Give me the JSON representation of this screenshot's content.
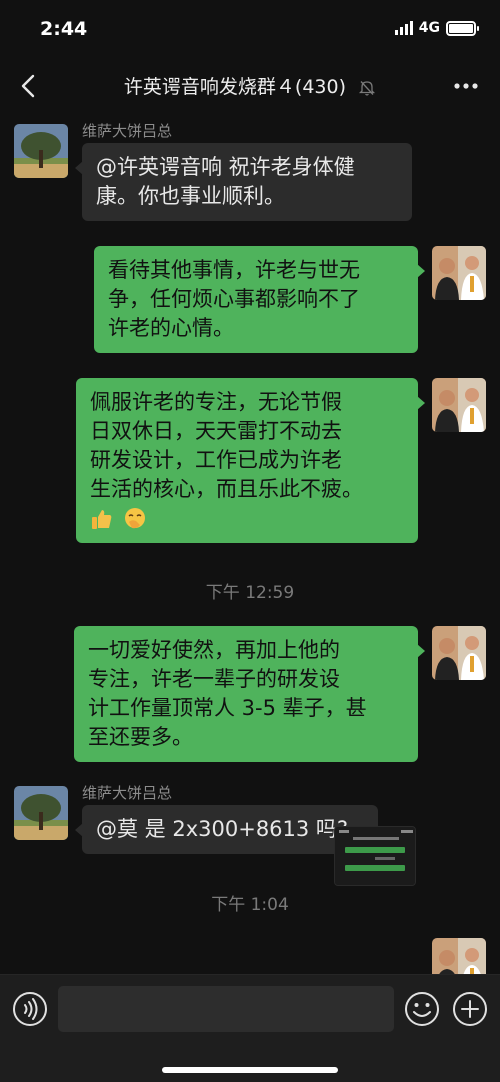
{
  "status_bar": {
    "time": "2:44",
    "network": "4G",
    "battery_level": 1.0
  },
  "header": {
    "title": "许英谔音响发烧群４(430)",
    "back_icon": "chevron-left-icon",
    "mute_icon": "bell-off-icon",
    "more_icon": "more-dots-icon"
  },
  "messages": [
    {
      "direction": "in",
      "sender": "维萨大饼吕总",
      "text": "@许英谔音响 祝许老身体健康。你也事业顺利。",
      "lines": [
        "@许英谔音响 祝许老身体健",
        "康。你也事业顺利。"
      ]
    },
    {
      "direction": "out",
      "text": "看待其他事情，许老与世无争，任何烦心事都影响不了许老的心情。",
      "lines": [
        "看待其他事情，许老与世无",
        "争，任何烦心事都影响不了",
        "许老的心情。"
      ]
    },
    {
      "direction": "out",
      "text": "佩服许老的专注，无论节假日双休日，天天雷打不动去研发设计，工作已成为许老生活的核心，而且乐此不疲。",
      "lines": [
        "佩服许老的专注，无论节假",
        "日双休日，天天雷打不动去",
        "研发设计，工作已成为许老",
        "生活的核心，而且乐此不疲。"
      ],
      "emojis": [
        "thumbs-up-icon",
        "hand-over-mouth-emoji-icon"
      ]
    },
    {
      "direction": "time",
      "text": "下午 12:59"
    },
    {
      "direction": "out",
      "text": "一切爱好使然，再加上他的专注，许老一辈子的研发设计工作量顶常人 3-5 辈子，甚至还要多。",
      "lines": [
        "一切爱好使然，再加上他的",
        "专注，许老一辈子的研发设",
        "计工作量顶常人 3-5 辈子，甚",
        "至还要多。"
      ]
    },
    {
      "direction": "in",
      "sender": "维萨大饼吕总",
      "text": "@莫 是 2x300+8613 吗?",
      "lines": [
        "@莫 是 2x300+8613 吗?"
      ]
    },
    {
      "direction": "time",
      "text": "下午 1:04"
    },
    {
      "direction": "out",
      "type": "image",
      "image_icon": "screenshot-thumbnail-icon"
    }
  ],
  "input_bar": {
    "placeholder": "",
    "voice_icon": "voice-icon",
    "emoji_icon": "smiley-icon",
    "plus_icon": "plus-circle-icon"
  },
  "colors": {
    "background": "#111111",
    "bubble_in": "#2c2c2c",
    "bubble_out": "#4fb35c",
    "meta_text": "#8c8c8c"
  }
}
